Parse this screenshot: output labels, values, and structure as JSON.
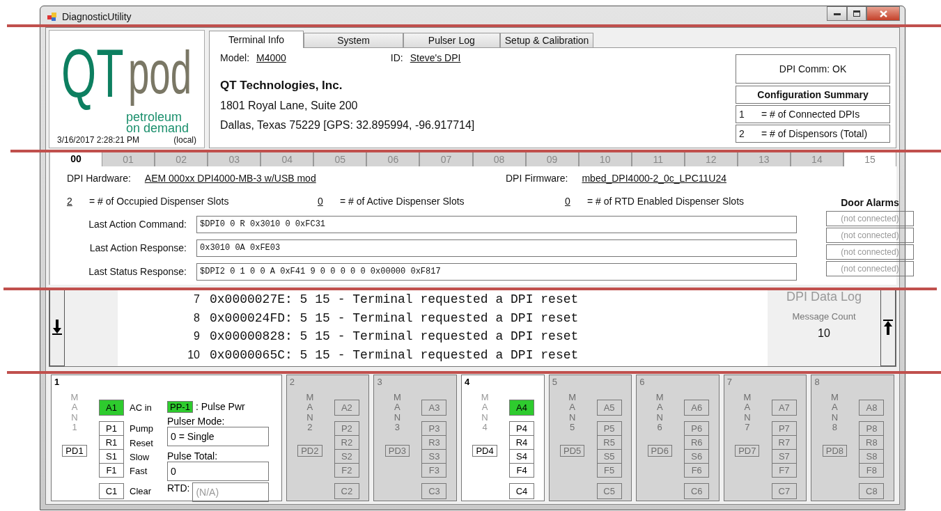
{
  "window": {
    "title": "DiagnosticUtility"
  },
  "logo": {
    "mark_1": "QT",
    "mark_2": "pod",
    "tagline": [
      "petroleum",
      "on demand"
    ]
  },
  "clock": {
    "time": "3/16/2017 2:28:21 PM",
    "zone": "(local)"
  },
  "tabs": [
    {
      "label": "Terminal Info",
      "selected": true
    },
    {
      "label": "System",
      "selected": false
    },
    {
      "label": "Pulser Log",
      "selected": false
    },
    {
      "label": "Setup & Calibration",
      "selected": false
    }
  ],
  "terminal": {
    "model_label": "Model:",
    "model": "M4000",
    "id_label": "ID:",
    "id": "Steve's DPI",
    "company": "QT Technologies, Inc.",
    "address": [
      "1801 Royal Lane, Suite 200",
      "Dallas, Texas 75229 [GPS: 32.895994, -96.917714]"
    ]
  },
  "comm_status": "DPI Comm: OK",
  "config_summary": {
    "title": "Configuration Summary",
    "rows": [
      {
        "value": "1",
        "label": "= # of Connected DPIs"
      },
      {
        "value": "2",
        "label": "= # of Dispensors (Total)"
      }
    ]
  },
  "channel_tabs": [
    {
      "label": "00",
      "selected": true,
      "disabled": false
    },
    {
      "label": "01",
      "selected": false,
      "disabled": true
    },
    {
      "label": "02",
      "selected": false,
      "disabled": true
    },
    {
      "label": "03",
      "selected": false,
      "disabled": true
    },
    {
      "label": "04",
      "selected": false,
      "disabled": true
    },
    {
      "label": "05",
      "selected": false,
      "disabled": true
    },
    {
      "label": "06",
      "selected": false,
      "disabled": true
    },
    {
      "label": "07",
      "selected": false,
      "disabled": true
    },
    {
      "label": "08",
      "selected": false,
      "disabled": true
    },
    {
      "label": "09",
      "selected": false,
      "disabled": true
    },
    {
      "label": "10",
      "selected": false,
      "disabled": true
    },
    {
      "label": "11",
      "selected": false,
      "disabled": true
    },
    {
      "label": "12",
      "selected": false,
      "disabled": true
    },
    {
      "label": "13",
      "selected": false,
      "disabled": true
    },
    {
      "label": "14",
      "selected": false,
      "disabled": true
    },
    {
      "label": "15",
      "selected": false,
      "disabled": false
    }
  ],
  "dpi": {
    "hardware_label": "DPI Hardware:",
    "hardware": "AEM 000xx DPI4000-MB-3 w/USB mod",
    "firmware_label": "DPI Firmware:",
    "firmware": "mbed_DPI4000-2_0c_LPC11U24",
    "counts": [
      {
        "value": "2",
        "label": "= # of Occupied Dispenser Slots"
      },
      {
        "value": "0",
        "label": "= # of Active Dispenser Slots"
      },
      {
        "value": "0",
        "label": "= # of RTD Enabled Dispenser Slots"
      }
    ],
    "messages": [
      {
        "label": "Last Action Command:",
        "value": "$DPI0 0 R 0x3010 0 0xFC31"
      },
      {
        "label": "Last Action Response:",
        "value": "0x3010 0A 0xFE03"
      },
      {
        "label": "Last Status Response:",
        "value": "$DPI2 0 1 0 0 A 0xF41 9 0 0 0 0 0 0x00000 0xF817"
      }
    ]
  },
  "door_alarms": {
    "title": "Door Alarms",
    "items": [
      "(not connected)",
      "(not connected)",
      "(not connected)",
      "(not connected)"
    ]
  },
  "log": {
    "title": "DPI Data Log",
    "count_label": "Message Count",
    "count": "10",
    "rows": [
      {
        "index": "7",
        "text": "0x0000027E: 5 15 - Terminal requested a DPI reset"
      },
      {
        "index": "8",
        "text": "0x000024FD: 5 15 - Terminal requested a DPI reset"
      },
      {
        "index": "9",
        "text": "0x00000828: 5 15 - Terminal requested a DPI reset"
      },
      {
        "index": "10",
        "text": "0x0000065C: 5 15 - Terminal requested a DPI reset"
      }
    ]
  },
  "dispensers": [
    {
      "number": "1",
      "kind": "detailed",
      "enabled": true,
      "man": "MAN1",
      "pd": "PD1",
      "ac": {
        "code": "A1",
        "label": "AC in",
        "on": true
      },
      "controls": [
        {
          "code": "P1",
          "label": "Pump"
        },
        {
          "code": "R1",
          "label": "Reset"
        },
        {
          "code": "S1",
          "label": "Slow"
        },
        {
          "code": "F1",
          "label": "Fast"
        }
      ],
      "clear": {
        "code": "C1",
        "label": "Clear"
      },
      "pulse": {
        "power_code": "PP-1",
        "power_on": true,
        "power_label": ": Pulse Pwr",
        "mode_label": "Pulser Mode:",
        "mode": "0 = Single",
        "total_label": "Pulse Total:",
        "total": "0",
        "rtd_label": "RTD:",
        "rtd": "(N/A)"
      }
    },
    {
      "number": "2",
      "kind": "compact",
      "enabled": false,
      "man": "MAN2",
      "pd": "PD2",
      "ac": {
        "code": "A2",
        "on": false
      },
      "controls": [
        {
          "code": "P2"
        },
        {
          "code": "R2"
        },
        {
          "code": "S2"
        },
        {
          "code": "F2"
        }
      ],
      "clear": {
        "code": "C2"
      }
    },
    {
      "number": "3",
      "kind": "compact",
      "enabled": false,
      "man": "MAN3",
      "pd": "PD3",
      "ac": {
        "code": "A3",
        "on": false
      },
      "controls": [
        {
          "code": "P3"
        },
        {
          "code": "R3"
        },
        {
          "code": "S3"
        },
        {
          "code": "F3"
        }
      ],
      "clear": {
        "code": "C3"
      }
    },
    {
      "number": "4",
      "kind": "compact",
      "enabled": true,
      "man": "MAN4",
      "pd": "PD4",
      "ac": {
        "code": "A4",
        "on": true
      },
      "controls": [
        {
          "code": "P4"
        },
        {
          "code": "R4"
        },
        {
          "code": "S4"
        },
        {
          "code": "F4"
        }
      ],
      "clear": {
        "code": "C4"
      }
    },
    {
      "number": "5",
      "kind": "compact",
      "enabled": false,
      "man": "MAN5",
      "pd": "PD5",
      "ac": {
        "code": "A5",
        "on": false
      },
      "controls": [
        {
          "code": "P5"
        },
        {
          "code": "R5"
        },
        {
          "code": "S5"
        },
        {
          "code": "F5"
        }
      ],
      "clear": {
        "code": "C5"
      }
    },
    {
      "number": "6",
      "kind": "compact",
      "enabled": false,
      "man": "MAN6",
      "pd": "PD6",
      "ac": {
        "code": "A6",
        "on": false
      },
      "controls": [
        {
          "code": "P6"
        },
        {
          "code": "R6"
        },
        {
          "code": "S6"
        },
        {
          "code": "F6"
        }
      ],
      "clear": {
        "code": "C6"
      }
    },
    {
      "number": "7",
      "kind": "compact",
      "enabled": false,
      "man": "MAN7",
      "pd": "PD7",
      "ac": {
        "code": "A7",
        "on": false
      },
      "controls": [
        {
          "code": "P7"
        },
        {
          "code": "R7"
        },
        {
          "code": "S7"
        },
        {
          "code": "F7"
        }
      ],
      "clear": {
        "code": "C7"
      }
    },
    {
      "number": "8",
      "kind": "compact",
      "enabled": false,
      "man": "MAN8",
      "pd": "PD8",
      "ac": {
        "code": "A8",
        "on": false
      },
      "controls": [
        {
          "code": "P8"
        },
        {
          "code": "R8"
        },
        {
          "code": "S8"
        },
        {
          "code": "F8"
        }
      ],
      "clear": {
        "code": "C8"
      }
    }
  ]
}
